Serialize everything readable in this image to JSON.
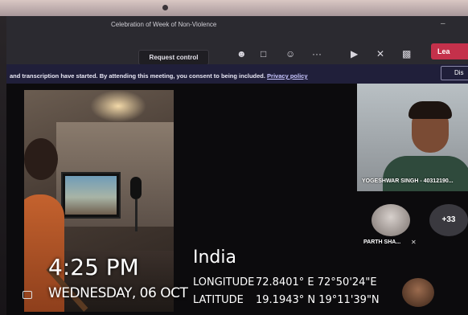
{
  "window": {
    "title": "Celebration of Week of Non-Violence",
    "minimize": "–"
  },
  "toolbar": {
    "request_control": "Request control",
    "icons": [
      "participants-icon",
      "chat-icon",
      "reactions-icon",
      "more-icon",
      "camera-icon",
      "mic-icon",
      "share-icon"
    ],
    "leave_label": "Lea"
  },
  "banner": {
    "text": "and transcription have started.  By attending this meeting, you consent to being included. ",
    "link": "Privacy policy",
    "dismiss": "Dis"
  },
  "overlay": {
    "time": "4:25 PM",
    "date": "WEDNESDAY, 06 OCT",
    "place": "India",
    "longitude_label": "LONGITUDE",
    "longitude_value": "72.8401° E  72°50'24\"E",
    "latitude_label": "LATITUDE",
    "latitude_value": "19.1943° N  19°11'39\"N"
  },
  "participants": {
    "right_video_name": "YOGESHWAR SINGH - 40312190...",
    "parth_name": "PARTH SHA...",
    "more_count": "+33"
  },
  "colors": {
    "leave": "#c4314b",
    "banner": "#201f3a",
    "toolbar": "#2b2a30"
  }
}
